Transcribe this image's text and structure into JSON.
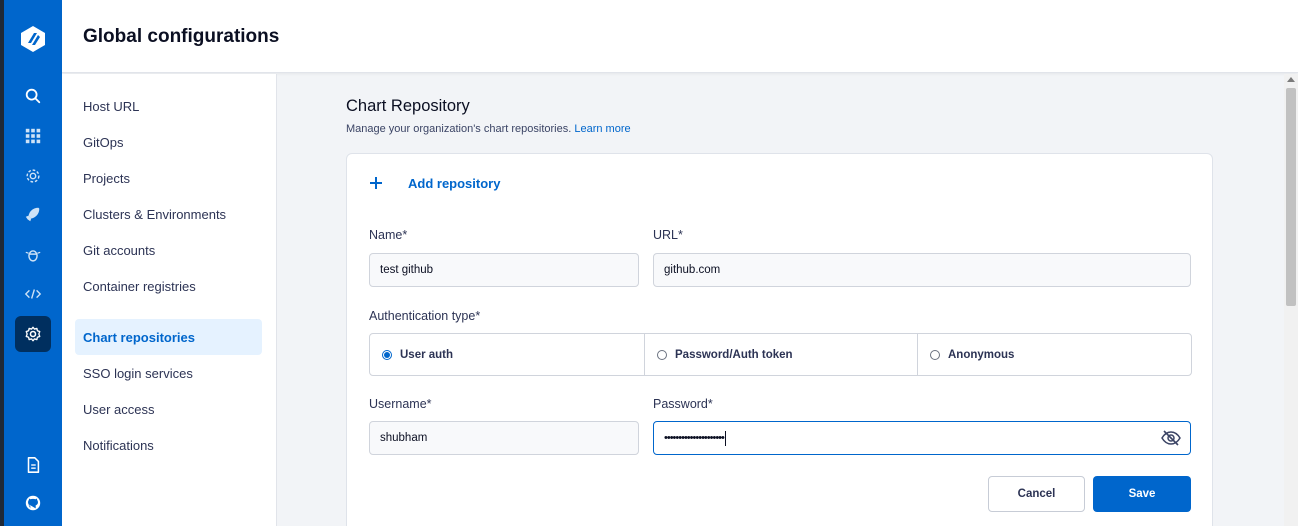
{
  "header": {
    "title": "Global configurations"
  },
  "rail": {
    "icons": [
      "logo-icon",
      "search-icon",
      "apps-grid-icon",
      "gear-outline-icon",
      "rocket-icon",
      "bug-icon",
      "code-icon",
      "settings-icon",
      "document-icon",
      "github-icon"
    ],
    "active": "settings-icon",
    "brand_color": "#0066cc"
  },
  "sidenav": {
    "items": [
      {
        "label": "Host URL"
      },
      {
        "label": "GitOps"
      },
      {
        "label": "Projects"
      },
      {
        "label": "Clusters & Environments"
      },
      {
        "label": "Git accounts"
      },
      {
        "label": "Container registries"
      },
      {
        "label": "Chart repositories"
      },
      {
        "label": "SSO login services"
      },
      {
        "label": "User access"
      },
      {
        "label": "Notifications"
      }
    ],
    "active": "Chart repositories"
  },
  "main": {
    "title": "Chart Repository",
    "subtitle": "Manage your organization's chart repositories.",
    "learn_more": "Learn more",
    "add_repository": "Add repository",
    "form": {
      "name_label": "Name*",
      "name_value": "test github",
      "url_label": "URL*",
      "url_value": "github.com",
      "auth_label": "Authentication type*",
      "auth_options": [
        "User auth",
        "Password/Auth token",
        "Anonymous"
      ],
      "auth_selected": "User auth",
      "username_label": "Username*",
      "username_value": "shubham",
      "password_label": "Password*",
      "password_value": "•••••••••••••••••••••",
      "cancel_label": "Cancel",
      "save_label": "Save"
    }
  }
}
